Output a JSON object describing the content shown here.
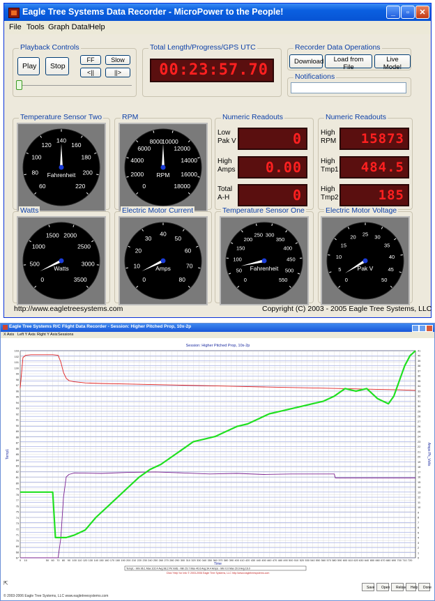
{
  "window1": {
    "title": "Eagle Tree Systems Data Recorder - MicroPower to the People!",
    "menu": [
      "File",
      "Tools",
      "Graph Data!",
      "Help"
    ]
  },
  "playback": {
    "label": "Playback Controls",
    "play": "Play",
    "stop": "Stop",
    "ff": "FF",
    "slow": "Slow",
    "back": "<||",
    "fwd": "||>"
  },
  "total": {
    "label": "Total Length/Progress/GPS UTC",
    "value": "00:23:57.70"
  },
  "recorder": {
    "label": "Recorder Data Operations",
    "download": "Download",
    "load": "Load from File",
    "live": "Live Mode!"
  },
  "notifications": {
    "label": "Notifications",
    "value": ""
  },
  "numeric_left": {
    "label": "Numeric Readouts",
    "rows": [
      {
        "name": "Low Pak V",
        "value": "0"
      },
      {
        "name": "High Amps",
        "value": "0.00"
      },
      {
        "name": "Total A-H",
        "value": "0"
      }
    ]
  },
  "numeric_right": {
    "label": "Numeric Readouts",
    "rows": [
      {
        "name": "High RPM",
        "value": "15873"
      },
      {
        "name": "High Tmp1",
        "value": "484.5"
      },
      {
        "name": "High Tmp2",
        "value": "185"
      }
    ]
  },
  "gauges": [
    {
      "label": "Temperature Sensor Two",
      "unit": "Fahrenheit",
      "ticks": [
        "60",
        "80",
        "100",
        "120",
        "140",
        "160",
        "180",
        "200",
        "220"
      ],
      "level": 0.5
    },
    {
      "label": "RPM",
      "unit": "RPM",
      "ticks": [
        "0",
        "2000",
        "4000",
        "6000",
        "8000",
        "10000",
        "12000",
        "14000",
        "16000",
        "18000"
      ],
      "level": 0.5
    },
    {
      "label": "Watts",
      "unit": "Watts",
      "ticks": [
        "0",
        "500",
        "1000",
        "1500",
        "2000",
        "2500",
        "3000",
        "3500"
      ],
      "level": 0.07
    },
    {
      "label": "Electric Motor Current",
      "unit": "Amps",
      "ticks": [
        "0",
        "10",
        "20",
        "30",
        "40",
        "50",
        "60",
        "70",
        "80"
      ],
      "level": 0.07
    },
    {
      "label": "Temperature Sensor One",
      "unit": "Fahrenheit",
      "ticks": [
        "0",
        "50",
        "100",
        "150",
        "200",
        "250",
        "300",
        "350",
        "400",
        "450",
        "500",
        "550"
      ],
      "level": 0.12
    },
    {
      "label": "Electric Motor Voltage",
      "unit": "Pak V",
      "ticks": [
        "0",
        "5",
        "10",
        "15",
        "20",
        "25",
        "30",
        "35",
        "40",
        "45",
        "50"
      ],
      "level": 0.05
    }
  ],
  "footer": {
    "url": "http://www.eagletreesystems.com",
    "copyright": "Copyright (C) 2003 - 2005 Eagle Tree Systems, LLC"
  },
  "window2": {
    "title": "Eagle Tree Systems R/C Flight Data Recorder - Session: Higher Pitched Prop, 10x-2p",
    "menu": [
      "X Axis",
      "Left Y Axis",
      "Right Y Axis",
      "Sessions"
    ],
    "status": "© 2003-2006 Eagle Tree Systems, LLC    www.eagletreesystems.com",
    "buttons": [
      "Save",
      "Open",
      "Reload",
      "Help",
      "Done"
    ],
    "hint": "Click 'Help' for Info         © 2003-2006 Eagle Tree Systems, LLC      http://www.eagletreesystems.com"
  },
  "chart_data": {
    "type": "line",
    "title": "Session: Higher Pitched Prop, 10x-2p",
    "xlabel": "Time",
    "ylabel_left": "Temp1",
    "ylabel_right": "Amps  Pk_Volts",
    "xlim": [
      0,
      730
    ],
    "ylim_left": [
      67,
      103
    ],
    "ylim_right": [
      0,
      41
    ],
    "x_ticks": [
      0,
      10,
      50,
      60,
      70,
      80,
      90,
      100,
      110,
      120,
      130,
      140,
      150,
      160,
      170,
      180,
      190,
      200,
      210,
      220,
      230,
      240,
      250,
      260,
      270,
      280,
      290,
      300,
      310,
      320,
      330,
      340,
      350,
      360,
      370,
      380,
      390,
      400,
      410,
      420,
      430,
      440,
      450,
      460,
      470,
      480,
      490,
      500,
      510,
      520,
      530,
      540,
      550,
      560,
      570,
      580,
      590,
      600,
      610,
      620,
      630,
      640,
      650,
      660,
      670,
      680,
      690,
      700,
      710,
      720
    ],
    "y_left_ticks": [
      67,
      68,
      69,
      70,
      71,
      72,
      73,
      74,
      75,
      76,
      77,
      78,
      79,
      80,
      81,
      82,
      83,
      84,
      85,
      86,
      87,
      88,
      89,
      90,
      91,
      92,
      93,
      94,
      95,
      96,
      97,
      98,
      99,
      100,
      101,
      102,
      103
    ],
    "y_right_ticks": [
      0,
      1,
      2,
      3,
      4,
      5,
      6,
      7,
      8,
      9,
      10,
      11,
      12,
      13,
      14,
      15,
      16,
      17,
      18,
      19,
      20,
      21,
      22,
      23,
      24,
      25,
      26,
      27,
      28,
      29,
      30,
      31,
      32,
      33,
      34,
      35,
      36,
      37,
      38,
      39,
      40,
      41
    ],
    "legend": "Temp1 - Min 96.1 Max 102.4 Avg 98.2    Pk Volts - Min 29.7 Max 40.6 Avg 34.4    Amps - Min 0.0 Max 20.9 Avg 16.0",
    "legend_position": "bottom",
    "grid": true,
    "series": [
      {
        "name": "Temp1",
        "axis": "left",
        "color": "#e02020",
        "x": [
          0,
          5,
          10,
          20,
          40,
          60,
          70,
          75,
          80,
          85,
          90,
          100,
          120,
          150,
          200,
          250,
          300,
          350,
          400,
          450,
          500,
          550,
          600,
          650,
          700,
          730
        ],
        "y": [
          96.5,
          101.8,
          102.2,
          102.3,
          102.3,
          102.3,
          102.2,
          101,
          99.2,
          98.2,
          97.8,
          97.6,
          97.4,
          97.3,
          97.2,
          97.1,
          97.0,
          96.9,
          96.8,
          96.7,
          96.6,
          96.5,
          96.4,
          96.3,
          96.2,
          96.1
        ]
      },
      {
        "name": "Amps",
        "axis": "right",
        "color": "#7a2090",
        "x": [
          0,
          60,
          70,
          75,
          80,
          85,
          90,
          100,
          150,
          200,
          250,
          300,
          350,
          400,
          450,
          500,
          550,
          580,
          582,
          600,
          650,
          700,
          730
        ],
        "y": [
          0,
          0,
          0,
          4,
          12,
          16,
          16.5,
          16.8,
          16.7,
          16.9,
          17.0,
          16.8,
          16.6,
          16.7,
          16.5,
          16.6,
          16.6,
          16.6,
          15.8,
          15.8,
          15.8,
          15.8,
          15.8
        ]
      },
      {
        "name": "Pk Volts",
        "axis": "right",
        "color": "#20e020",
        "x": [
          0,
          60,
          65,
          85,
          100,
          120,
          140,
          160,
          180,
          200,
          220,
          240,
          260,
          280,
          300,
          320,
          340,
          360,
          380,
          400,
          420,
          440,
          460,
          480,
          500,
          520,
          540,
          560,
          580,
          600,
          620,
          640,
          660,
          680,
          690,
          700,
          710,
          720,
          730
        ],
        "y": [
          13,
          13,
          4,
          4,
          4.5,
          5.5,
          8,
          10,
          12,
          14,
          16,
          17.5,
          18.5,
          20,
          21.5,
          23,
          23.5,
          24,
          25,
          26,
          26.5,
          27.5,
          28.5,
          29,
          29.5,
          30,
          30.5,
          31,
          32,
          33.5,
          33,
          33.5,
          31.5,
          30.5,
          32,
          35,
          38,
          40,
          41
        ]
      }
    ]
  }
}
